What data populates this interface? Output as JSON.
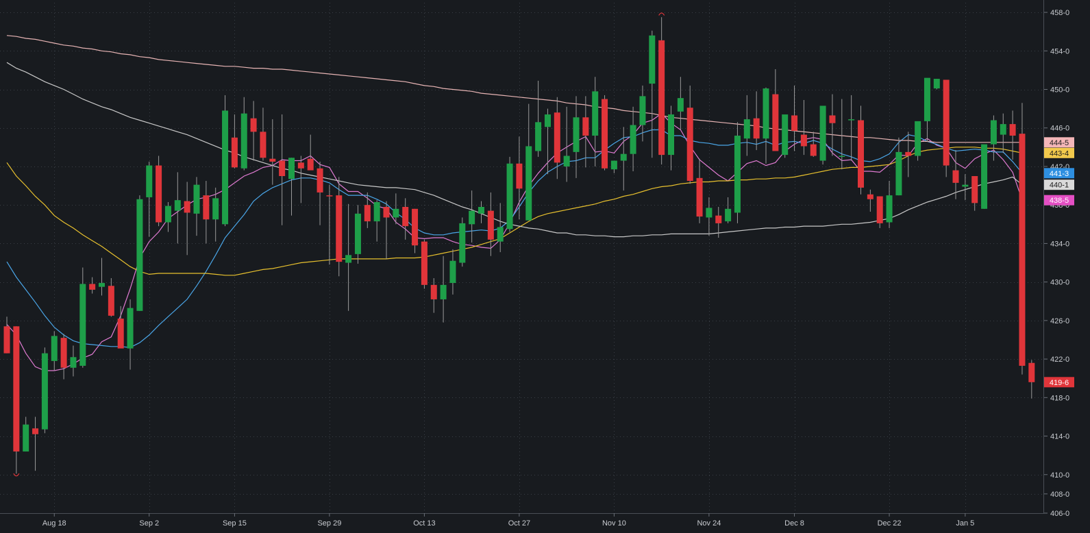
{
  "colors": {
    "background": "#181b1f",
    "grid": "#3a3f46",
    "axis_text": "#c9ccd1",
    "up": "#1e9f49",
    "down": "#e0353a",
    "wick": "#9a9a9a"
  },
  "chart_data": {
    "type": "candlestick",
    "ylim": [
      406,
      459
    ],
    "y_ticks": [
      "406-0",
      "408-0",
      "410-0",
      "414-0",
      "418-0",
      "422-0",
      "426-0",
      "430-0",
      "434-0",
      "438-0",
      "442-0",
      "446-0",
      "450-0",
      "454-0",
      "458-0"
    ],
    "y_tick_values": [
      406,
      408,
      410,
      414,
      418,
      422,
      426,
      430,
      434,
      438,
      442,
      446,
      450,
      454,
      458
    ],
    "x_ticks": [
      "Aug 18",
      "Sep 2",
      "Sep 15",
      "Sep 29",
      "Oct 13",
      "Oct 27",
      "Nov 10",
      "Nov 24",
      "Dec 8",
      "Dec 22",
      "Jan 5"
    ],
    "x_tick_index": [
      5,
      15,
      24,
      34,
      44,
      54,
      64,
      74,
      83,
      93,
      101
    ],
    "candles": [
      [
        425.4,
        426.4,
        422.6,
        422.6
      ],
      [
        425.4,
        425.4,
        410.1,
        412.4
      ],
      [
        412.4,
        416.0,
        412.4,
        415.2
      ],
      [
        414.8,
        416.0,
        410.4,
        414.2
      ],
      [
        414.7,
        423.2,
        414.3,
        422.6
      ],
      [
        421.8,
        424.9,
        420.8,
        424.4
      ],
      [
        424.2,
        424.6,
        419.9,
        421.1
      ],
      [
        421.1,
        423.4,
        420.2,
        422.2
      ],
      [
        421.3,
        431.5,
        421.1,
        429.8
      ],
      [
        429.8,
        430.5,
        428.8,
        429.2
      ],
      [
        429.5,
        432.5,
        428.6,
        429.9
      ],
      [
        429.6,
        430.4,
        426.4,
        426.5
      ],
      [
        426.2,
        427.5,
        423.5,
        423.1
      ],
      [
        423.1,
        428.2,
        420.9,
        427.3
      ],
      [
        427.0,
        439.0,
        427.0,
        438.6
      ],
      [
        438.8,
        442.5,
        434.7,
        442.1
      ],
      [
        442.1,
        443.1,
        435.8,
        436.2
      ],
      [
        436.2,
        438.3,
        435.2,
        437.9
      ],
      [
        437.4,
        441.4,
        434.0,
        438.5
      ],
      [
        438.4,
        440.4,
        432.8,
        437.2
      ],
      [
        437.1,
        440.9,
        434.8,
        440.1
      ],
      [
        439.0,
        440.5,
        434.0,
        436.5
      ],
      [
        436.5,
        439.8,
        434.2,
        438.7
      ],
      [
        436.0,
        449.4,
        435.8,
        447.8
      ],
      [
        445.0,
        447.4,
        441.8,
        441.9
      ],
      [
        441.8,
        449.2,
        441.6,
        447.5
      ],
      [
        447.0,
        448.8,
        442.6,
        445.6
      ],
      [
        445.6,
        448.1,
        442.6,
        442.9
      ],
      [
        442.8,
        446.9,
        440.1,
        442.5
      ],
      [
        442.6,
        447.4,
        435.9,
        441.0
      ],
      [
        440.7,
        442.9,
        436.9,
        442.9
      ],
      [
        442.4,
        443.1,
        438.2,
        441.8
      ],
      [
        442.8,
        445.3,
        442.8,
        441.6
      ],
      [
        441.8,
        442.5,
        435.9,
        439.3
      ],
      [
        439.0,
        440.1,
        431.8,
        438.9
      ],
      [
        439.0,
        440.9,
        430.6,
        432.1
      ],
      [
        432.0,
        438.1,
        427.0,
        432.8
      ],
      [
        432.9,
        438.0,
        431.9,
        437.1
      ],
      [
        438.0,
        439.3,
        435.6,
        436.3
      ],
      [
        436.3,
        438.5,
        434.2,
        438.3
      ],
      [
        437.8,
        438.4,
        432.4,
        436.7
      ],
      [
        436.7,
        439.2,
        436.0,
        437.6
      ],
      [
        437.8,
        438.7,
        434.4,
        435.8
      ],
      [
        437.6,
        437.6,
        433.0,
        433.8
      ],
      [
        434.2,
        434.4,
        429.3,
        429.7
      ],
      [
        429.7,
        430.4,
        426.8,
        428.2
      ],
      [
        428.2,
        432.7,
        425.8,
        429.7
      ],
      [
        429.9,
        433.4,
        428.7,
        432.2
      ],
      [
        432.0,
        436.7,
        431.6,
        436.1
      ],
      [
        436.0,
        439.5,
        434.1,
        437.4
      ],
      [
        437.1,
        438.4,
        436.1,
        437.8
      ],
      [
        437.4,
        439.3,
        432.7,
        434.4
      ],
      [
        434.2,
        438.2,
        433.1,
        435.7
      ],
      [
        435.5,
        443.0,
        435.2,
        442.3
      ],
      [
        442.3,
        445.1,
        436.5,
        439.7
      ],
      [
        436.4,
        448.5,
        436.4,
        444.1
      ],
      [
        443.6,
        450.9,
        443.0,
        446.6
      ],
      [
        446.1,
        448.0,
        441.2,
        447.4
      ],
      [
        447.6,
        449.2,
        440.7,
        442.4
      ],
      [
        442.0,
        448.2,
        440.4,
        443.1
      ],
      [
        443.5,
        449.3,
        440.8,
        447.1
      ],
      [
        447.1,
        449.3,
        441.9,
        445.2
      ],
      [
        445.2,
        451.3,
        442.0,
        449.8
      ],
      [
        449.0,
        449.4,
        441.6,
        441.8
      ],
      [
        441.7,
        442.5,
        441.3,
        442.6
      ],
      [
        442.6,
        446.1,
        439.5,
        443.3
      ],
      [
        443.3,
        448.2,
        441.5,
        446.3
      ],
      [
        446.3,
        450.4,
        444.6,
        449.3
      ],
      [
        450.6,
        456.1,
        442.9,
        455.6
      ],
      [
        455.1,
        457.5,
        442.2,
        443.2
      ],
      [
        443.2,
        448.3,
        441.6,
        447.4
      ],
      [
        447.7,
        451.3,
        445.8,
        449.1
      ],
      [
        448.1,
        450.4,
        440.2,
        440.5
      ],
      [
        440.8,
        442.8,
        436.1,
        436.8
      ],
      [
        436.7,
        438.8,
        434.8,
        437.7
      ],
      [
        436.9,
        437.8,
        434.6,
        436.1
      ],
      [
        436.3,
        438.8,
        436.1,
        437.6
      ],
      [
        437.2,
        446.6,
        436.1,
        445.2
      ],
      [
        444.9,
        449.4,
        443.1,
        446.9
      ],
      [
        447.0,
        449.8,
        443.7,
        444.9
      ],
      [
        444.9,
        450.2,
        442.3,
        450.1
      ],
      [
        449.5,
        452.1,
        444.9,
        443.6
      ],
      [
        443.2,
        446.3,
        442.9,
        447.4
      ],
      [
        447.3,
        450.4,
        443.6,
        445.7
      ],
      [
        445.3,
        448.9,
        443.2,
        444.1
      ],
      [
        444.3,
        445.6,
        443.0,
        443.1
      ],
      [
        442.6,
        446.1,
        442.2,
        448.3
      ],
      [
        447.3,
        449.5,
        443.1,
        446.5
      ],
      [
        443.1,
        449.0,
        441.7,
        443.1
      ],
      [
        446.9,
        449.4,
        442.6,
        446.9
      ],
      [
        446.8,
        448.3,
        439.1,
        439.8
      ],
      [
        439.1,
        439.6,
        437.3,
        438.6
      ],
      [
        438.9,
        438.9,
        435.6,
        436.1
      ],
      [
        436.2,
        440.5,
        435.6,
        439.0
      ],
      [
        439.0,
        445.0,
        439.0,
        443.5
      ],
      [
        443.5,
        445.6,
        440.9,
        443.1
      ],
      [
        443.1,
        446.6,
        442.6,
        446.7
      ],
      [
        446.7,
        451.1,
        444.6,
        451.2
      ],
      [
        450.1,
        451.1,
        450.0,
        451.1
      ],
      [
        451.0,
        450.8,
        440.9,
        442.1
      ],
      [
        441.6,
        443.7,
        438.6,
        440.3
      ],
      [
        439.9,
        441.2,
        438.5,
        440.1
      ],
      [
        441.0,
        441.0,
        437.4,
        438.2
      ],
      [
        437.6,
        441.7,
        437.6,
        444.3
      ],
      [
        444.3,
        447.3,
        442.6,
        446.8
      ],
      [
        445.3,
        447.5,
        443.4,
        446.4
      ],
      [
        446.4,
        447.8,
        442.7,
        445.2
      ],
      [
        445.4,
        448.6,
        420.4,
        421.3
      ],
      [
        421.6,
        421.9,
        417.9,
        419.6
      ]
    ],
    "series": [
      {
        "name": "",
        "color": "#e07bd2",
        "values": [
          425.6,
          424.5,
          422.6,
          421.2,
          420.8,
          420.8,
          421.0,
          421.5,
          422.1,
          422.5,
          423.8,
          424.3,
          426.5,
          429.3,
          432.5,
          434.2,
          435.2,
          436.6,
          437.3,
          438.0,
          438.6,
          438.8,
          439.1,
          439.6,
          440.3,
          441.0,
          441.4,
          441.9,
          442.1,
          442.7,
          442.6,
          442.6,
          443.1,
          442.2,
          441.9,
          440.2,
          439.4,
          439.4,
          438.7,
          437.9,
          437.6,
          436.2,
          435.5,
          434.6,
          434.5,
          434.6,
          434.6,
          434.2,
          433.9,
          433.8,
          433.6,
          433.5,
          434.4,
          436.1,
          438.3,
          440.0,
          441.3,
          442.4,
          443.4,
          444.0,
          444.6,
          445.1,
          443.5,
          443.6,
          443.4,
          444.6,
          445.3,
          446.5,
          446.8,
          447.5,
          446.5,
          445.8,
          444.1,
          442.7,
          441.9,
          441.1,
          440.5,
          441.4,
          442.3,
          442.6,
          442.1,
          442.4,
          443.6,
          444.3,
          444.8,
          445.0,
          444.8,
          443.4,
          442.6,
          442.7,
          441.5,
          441.5,
          441.4,
          442.2,
          443.2,
          443.1,
          444.4,
          444.9,
          444.2,
          443.9,
          442.4,
          441.8,
          442.8,
          443.3,
          443.7,
          442.7,
          441.4,
          438.5
        ]
      },
      {
        "name": "",
        "color": "#4aa6e8",
        "values": [
          432.1,
          430.5,
          429.2,
          427.9,
          426.5,
          425.3,
          424.5,
          423.9,
          423.6,
          423.5,
          423.4,
          423.3,
          423.3,
          423.2,
          423.7,
          424.5,
          425.5,
          426.4,
          427.3,
          428.2,
          429.6,
          431.1,
          432.8,
          434.6,
          435.8,
          437.0,
          438.4,
          439.2,
          439.8,
          440.2,
          440.6,
          440.8,
          440.8,
          440.6,
          440.3,
          439.6,
          439.0,
          439.0,
          439.0,
          438.6,
          438.1,
          437.2,
          436.5,
          435.6,
          435.1,
          434.9,
          434.9,
          435.1,
          435.2,
          435.3,
          435.4,
          435.3,
          435.6,
          436.4,
          437.8,
          439.3,
          440.5,
          441.4,
          442.0,
          442.5,
          442.6,
          442.9,
          442.9,
          443.7,
          444.4,
          445.0,
          445.1,
          445.5,
          445.8,
          445.8,
          445.2,
          445.2,
          444.7,
          444.5,
          444.4,
          444.2,
          444.2,
          444.4,
          444.5,
          444.3,
          444.6,
          444.2,
          444.5,
          444.6,
          444.4,
          444.7,
          444.4,
          443.8,
          443.3,
          443.0,
          442.6,
          442.5,
          442.8,
          443.3,
          444.5,
          445.3,
          445.1,
          444.6,
          444.3,
          443.9,
          443.6,
          443.7,
          443.8,
          443.7,
          443.5,
          443.5,
          442.5,
          441.3
        ]
      },
      {
        "name": "",
        "color": "#e8c12e",
        "values": [
          442.4,
          441.0,
          440.0,
          438.9,
          438.0,
          436.9,
          436.2,
          435.6,
          434.9,
          434.3,
          433.7,
          433.0,
          432.3,
          431.6,
          431.1,
          430.8,
          430.9,
          430.9,
          430.9,
          430.9,
          430.9,
          430.9,
          430.8,
          430.7,
          430.7,
          430.9,
          431.1,
          431.3,
          431.4,
          431.6,
          431.8,
          432.0,
          432.1,
          432.2,
          432.3,
          432.4,
          432.4,
          432.4,
          432.4,
          432.4,
          432.4,
          432.5,
          432.5,
          432.5,
          432.6,
          432.8,
          433.0,
          433.2,
          433.4,
          433.6,
          433.9,
          434.2,
          434.5,
          435.1,
          435.7,
          436.3,
          436.8,
          437.1,
          437.3,
          437.5,
          437.7,
          437.9,
          438.1,
          438.4,
          438.6,
          438.9,
          439.1,
          439.4,
          439.7,
          439.9,
          440.0,
          440.2,
          440.3,
          440.4,
          440.4,
          440.5,
          440.5,
          440.6,
          440.6,
          440.7,
          440.7,
          440.8,
          440.8,
          440.9,
          441.1,
          441.3,
          441.5,
          441.7,
          441.8,
          441.9,
          441.9,
          442.0,
          442.1,
          442.2,
          442.6,
          443.1,
          443.5,
          443.7,
          443.8,
          443.9,
          444.0,
          444.0,
          444.0,
          443.9,
          443.9,
          443.8,
          443.6,
          443.4
        ]
      },
      {
        "name": "",
        "color": "#c9c9c9",
        "values": [
          452.8,
          452.2,
          451.8,
          451.3,
          450.8,
          450.4,
          450.0,
          449.5,
          449.0,
          448.6,
          448.2,
          447.9,
          447.5,
          447.1,
          446.8,
          446.5,
          446.2,
          445.9,
          445.6,
          445.3,
          444.9,
          444.5,
          444.1,
          443.7,
          443.4,
          443.0,
          442.7,
          442.4,
          442.1,
          441.8,
          441.6,
          441.3,
          441.1,
          440.9,
          440.7,
          440.5,
          440.3,
          440.1,
          440.0,
          439.9,
          439.8,
          439.8,
          439.7,
          439.6,
          439.3,
          439.0,
          438.6,
          438.2,
          437.8,
          437.5,
          437.1,
          436.7,
          436.3,
          436.0,
          435.8,
          435.6,
          435.5,
          435.3,
          435.1,
          435.1,
          434.9,
          434.9,
          434.8,
          434.8,
          434.7,
          434.7,
          434.8,
          434.8,
          434.9,
          434.9,
          435.0,
          435.0,
          435.0,
          435.0,
          435.0,
          435.1,
          435.2,
          435.3,
          435.4,
          435.5,
          435.6,
          435.6,
          435.7,
          435.7,
          435.8,
          435.8,
          435.8,
          435.9,
          436.0,
          436.0,
          436.1,
          436.2,
          436.4,
          436.6,
          437.0,
          437.5,
          437.9,
          438.3,
          438.6,
          438.9,
          439.3,
          439.6,
          439.9,
          440.2,
          440.4,
          440.6,
          440.9,
          440.1
        ]
      },
      {
        "name": "",
        "color": "#e8b5b5",
        "values": [
          455.6,
          455.5,
          455.3,
          455.2,
          455.0,
          454.8,
          454.6,
          454.5,
          454.3,
          454.2,
          454.0,
          453.9,
          453.7,
          453.6,
          453.4,
          453.3,
          453.1,
          453.0,
          452.9,
          452.8,
          452.7,
          452.6,
          452.5,
          452.4,
          452.4,
          452.3,
          452.2,
          452.2,
          452.1,
          452.1,
          452.0,
          451.9,
          451.8,
          451.7,
          451.6,
          451.5,
          451.4,
          451.3,
          451.2,
          451.1,
          451.0,
          450.9,
          450.8,
          450.6,
          450.4,
          450.3,
          450.1,
          450.0,
          449.9,
          449.8,
          449.6,
          449.5,
          449.4,
          449.3,
          449.2,
          449.1,
          449.0,
          448.9,
          448.8,
          448.6,
          448.5,
          448.4,
          448.2,
          448.1,
          448.0,
          447.8,
          447.7,
          447.6,
          447.5,
          447.3,
          447.1,
          447.0,
          446.9,
          446.8,
          446.7,
          446.6,
          446.5,
          446.4,
          446.3,
          446.2,
          446.0,
          445.9,
          445.8,
          445.7,
          445.6,
          445.5,
          445.4,
          445.3,
          445.2,
          445.1,
          445.0,
          445.0,
          444.9,
          444.8,
          444.7,
          444.7,
          444.6,
          444.6,
          444.5,
          444.5,
          444.5,
          444.5,
          444.5,
          444.5,
          444.5,
          444.5,
          444.5,
          444.5
        ]
      }
    ],
    "price_labels": [
      {
        "text": "444-5",
        "value": 444.5,
        "bg": "#f4b6b8",
        "fg": "#1b1b1b"
      },
      {
        "text": "443-4",
        "value": 443.4,
        "bg": "#f2c94c",
        "fg": "#1b1b1b"
      },
      {
        "text": "441-3",
        "value": 441.3,
        "bg": "#2e8fe0",
        "fg": "#ffffff"
      },
      {
        "text": "440-1",
        "value": 440.1,
        "bg": "#d9d9d9",
        "fg": "#1b1b1b"
      },
      {
        "text": "438-5",
        "value": 438.5,
        "bg": "#e44fc4",
        "fg": "#ffffff"
      },
      {
        "text": "419-6",
        "value": 419.6,
        "bg": "#e0353a",
        "fg": "#ffffff"
      }
    ],
    "markers": [
      {
        "index": 69,
        "value": 457.9,
        "kind": "high"
      },
      {
        "index": 1,
        "value": 409.9,
        "kind": "low"
      }
    ],
    "grid": true
  }
}
